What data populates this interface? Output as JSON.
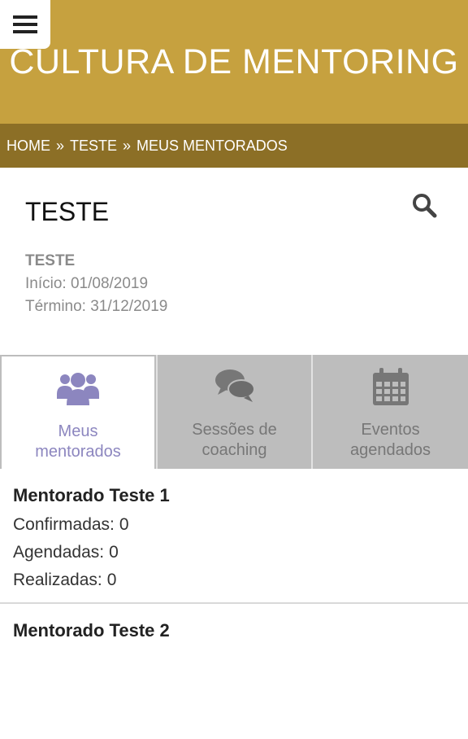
{
  "app": {
    "title": "CULTURA DE MENTORING",
    "menu_icon": "hamburger-menu-icon"
  },
  "breadcrumb": {
    "items": [
      "HOME",
      "TESTE",
      "MEUS MENTORADOS"
    ],
    "separator": "»"
  },
  "program": {
    "heading": "TESTE",
    "name": "TESTE",
    "start": "Início: 01/08/2019",
    "end": "Término: 31/12/2019",
    "search_icon": "search-icon"
  },
  "tabs": [
    {
      "label": "Meus mentorados",
      "icon": "group-icon",
      "active": true
    },
    {
      "label": "Sessões de coaching",
      "icon": "chat-bubbles-icon",
      "active": false
    },
    {
      "label": "Eventos agendados",
      "icon": "calendar-icon",
      "active": false
    }
  ],
  "mentees": [
    {
      "name": "Mentorado Teste 1",
      "confirmed_label": "Confirmadas:",
      "confirmed": "0",
      "scheduled_label": "Agendadas:",
      "scheduled": "0",
      "done_label": "Realizadas:",
      "done": "0"
    },
    {
      "name": "Mentorado Teste 2"
    }
  ],
  "colors": {
    "header": "#c6a13f",
    "breadcrumb": "#8c6f26",
    "tab_inactive": "#bdbdbd",
    "tab_active_text": "#8c86bf",
    "active_icon": "#8c86bf",
    "inactive_icon": "#777777"
  }
}
